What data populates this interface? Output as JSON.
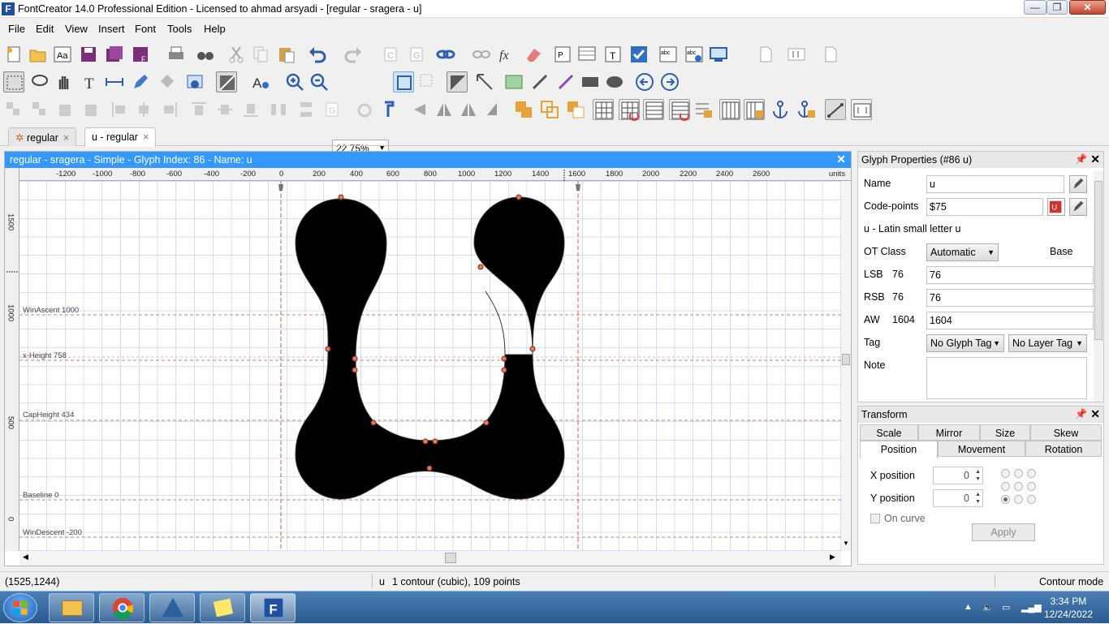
{
  "window": {
    "title": "FontCreator 14.0 Professional Edition - Licensed to ahmad arsyadi - [regular - sragera  - u]",
    "app_icon": "F"
  },
  "window_buttons": {
    "minimize": "—",
    "maximize": "❐",
    "close": "✕"
  },
  "menu": [
    "File",
    "Edit",
    "View",
    "Insert",
    "Font",
    "Tools",
    "Help"
  ],
  "toolbar": {
    "zoom": "22.75%"
  },
  "tabs": [
    {
      "label": "regular"
    },
    {
      "label": "u - regular"
    }
  ],
  "editor": {
    "header": "regular - sragera  - Simple - Glyph Index: 86 - Name: u",
    "ruler_top": [
      "-1200",
      "-1000",
      "-800",
      "-600",
      "-400",
      "-200",
      "0",
      "200",
      "400",
      "600",
      "800",
      "1000",
      "1200",
      "1400",
      "1600",
      "1800",
      "2000",
      "2200",
      "2400",
      "2600",
      "units"
    ],
    "ruler_left": [
      "1500",
      "1000",
      "500",
      "0"
    ],
    "metrics": [
      {
        "label": "WinAscent 1000"
      },
      {
        "label": "x-Height 758"
      },
      {
        "label": "CapHeight 434"
      },
      {
        "label": "Baseline 0"
      },
      {
        "label": "WinDescent -200"
      }
    ]
  },
  "glyph_props": {
    "title": "Glyph Properties (#86 u)",
    "name_label": "Name",
    "name_value": "u",
    "codepoints_label": "Code-points",
    "codepoints_value": "$75",
    "description": "u - Latin small letter u",
    "otclass_label": "OT Class",
    "otclass_value": "Automatic",
    "otclass_extra": "Base",
    "lsb_label": "LSB",
    "lsb_num": "76",
    "lsb_value": "76",
    "rsb_label": "RSB",
    "rsb_num": "76",
    "rsb_value": "76",
    "aw_label": "AW",
    "aw_num": "1604",
    "aw_value": "1604",
    "tag_label": "Tag",
    "glyph_tag": "No Glyph Tag",
    "layer_tag": "No Layer Tag",
    "note_label": "Note"
  },
  "transform": {
    "title": "Transform",
    "tabs_row1": [
      "Scale",
      "Mirror",
      "Size",
      "Skew"
    ],
    "tabs_row2": [
      "Position",
      "Movement",
      "Rotation"
    ],
    "x_label": "X position",
    "x_value": "0",
    "y_label": "Y position",
    "y_value": "0",
    "on_curve": "On curve",
    "apply": "Apply"
  },
  "status": {
    "coords": "(1525,1244)",
    "glyph": "u",
    "info": "1 contour (cubic), 109 points",
    "mode": "Contour mode"
  },
  "taskbar": {
    "time": "3:34 PM",
    "date": "12/24/2022"
  }
}
